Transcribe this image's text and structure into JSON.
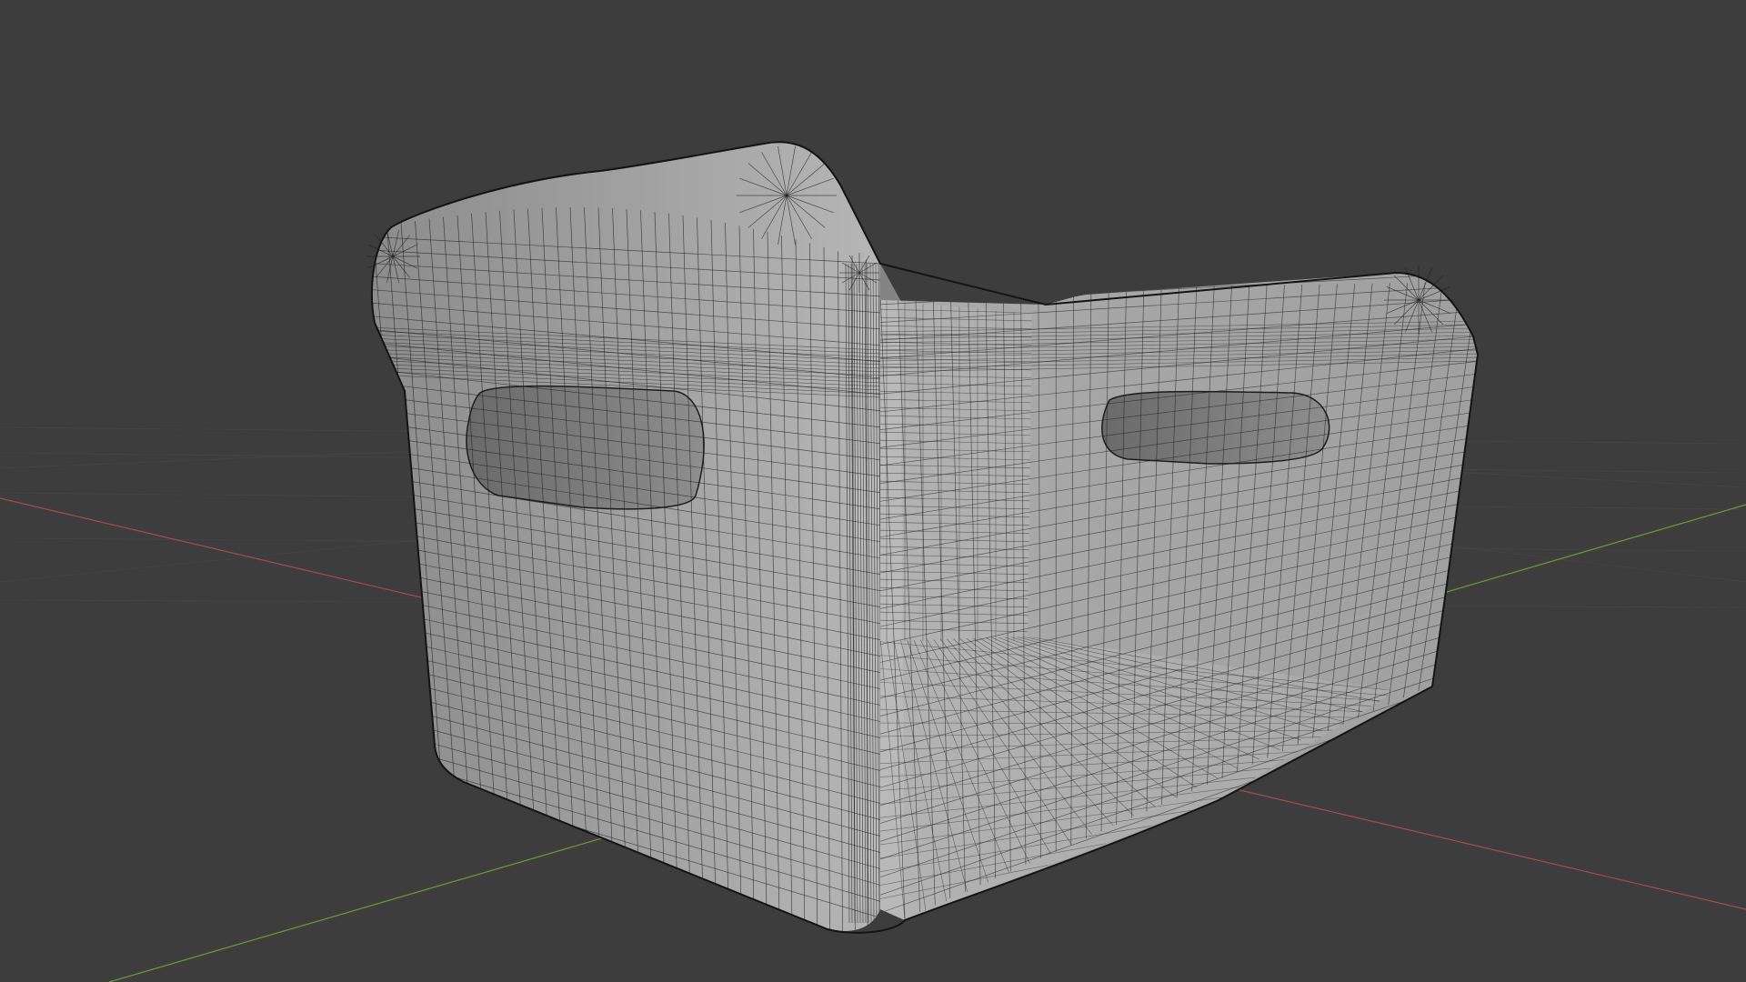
{
  "viewport": {
    "background_color": "#3d3d3d",
    "grid_color": "#4a4a4a",
    "x_axis_color": "#a84a55",
    "y_axis_color": "#6e9a3a"
  },
  "mesh": {
    "object": "crate",
    "shading": "solid-with-wireframe",
    "surface_light": "#b8b8b8",
    "surface_mid": "#9a9a9a",
    "surface_dark": "#7e7e7e",
    "wire_color": "#1c1c1c",
    "handle_holes": 2
  }
}
